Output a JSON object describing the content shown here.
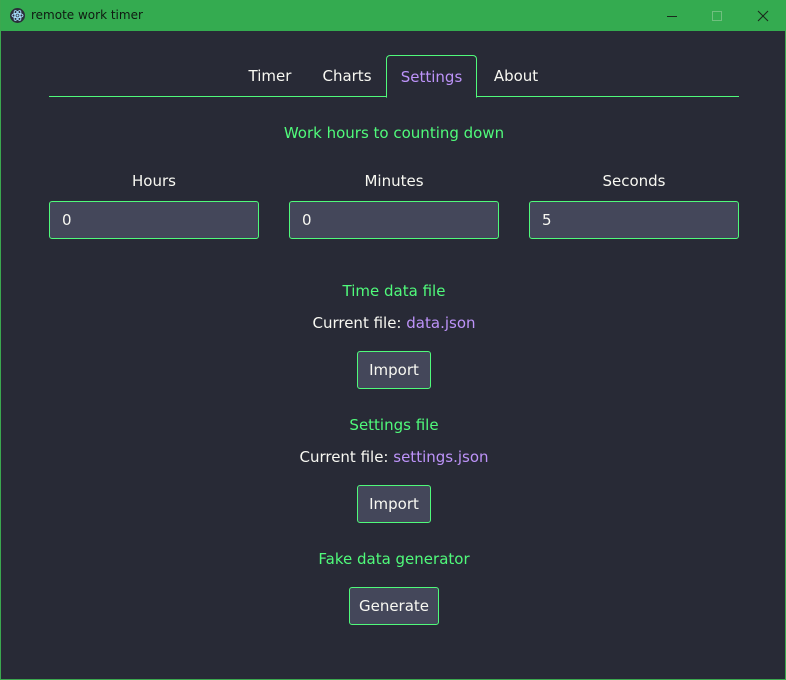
{
  "window": {
    "title": "remote work timer"
  },
  "tabs": [
    {
      "label": "Timer"
    },
    {
      "label": "Charts"
    },
    {
      "label": "Settings",
      "active": true
    },
    {
      "label": "About"
    }
  ],
  "countdown": {
    "heading": "Work hours to counting down",
    "hours": {
      "label": "Hours",
      "value": "0"
    },
    "minutes": {
      "label": "Minutes",
      "value": "0"
    },
    "seconds": {
      "label": "Seconds",
      "value": "5"
    }
  },
  "time_data": {
    "heading": "Time data file",
    "current_prefix": "Current file:",
    "file": "data.json",
    "button": "Import"
  },
  "settings_file": {
    "heading": "Settings file",
    "current_prefix": "Current file:",
    "file": "settings.json",
    "button": "Import"
  },
  "fake_data": {
    "heading": "Fake data generator",
    "button": "Generate"
  },
  "colors": {
    "accent": "#50fa7b",
    "highlight": "#bd93f9",
    "background": "#282a36",
    "titlebar": "#34ab50"
  },
  "icons": {
    "app": "electron-atom-icon",
    "minimize": "minimize-icon",
    "maximize": "maximize-icon",
    "close": "close-icon"
  }
}
